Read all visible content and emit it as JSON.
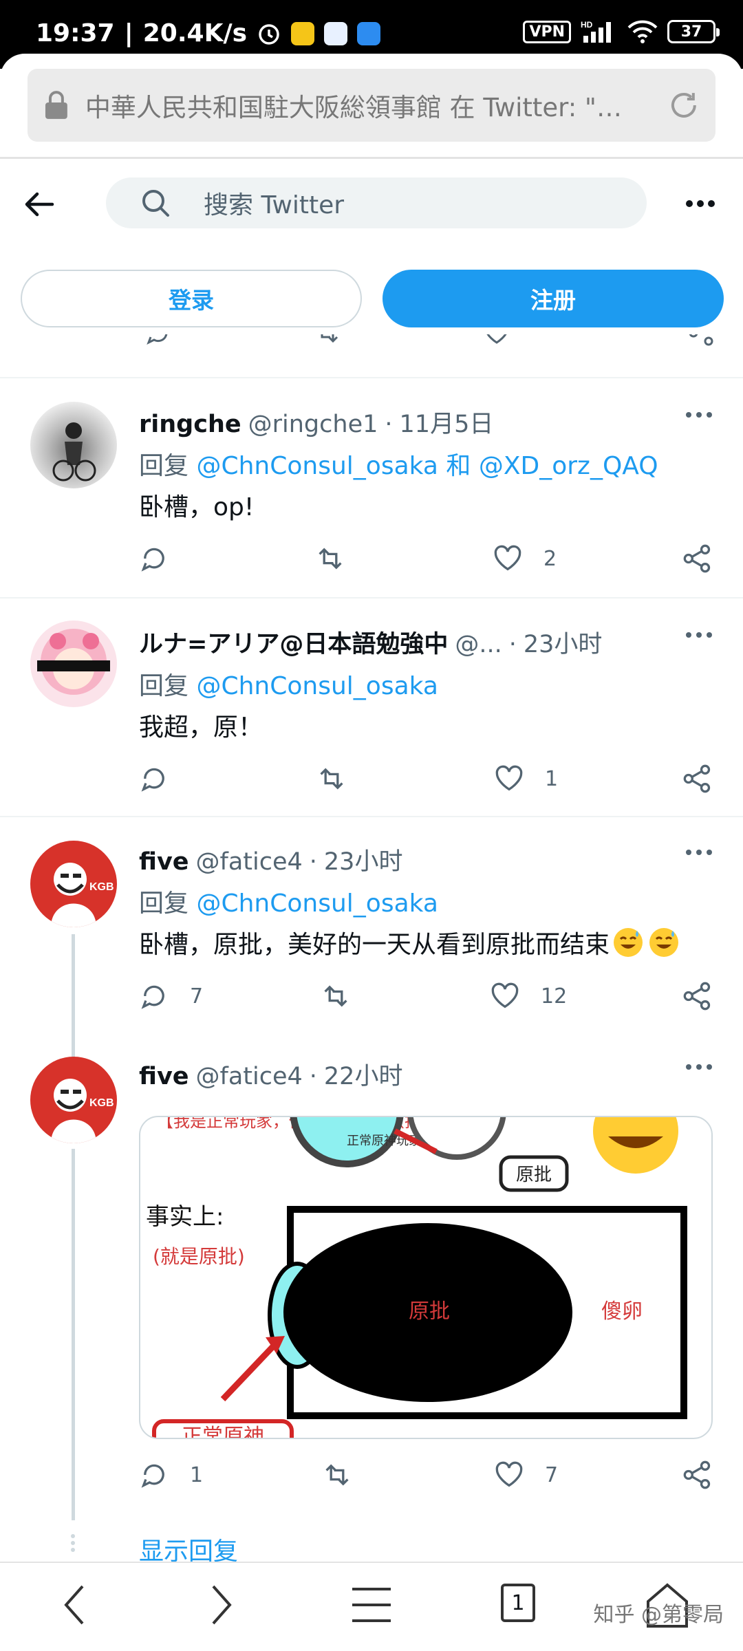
{
  "status_bar": {
    "time": "19:37",
    "speed": "20.4K/s",
    "vpn": "VPN",
    "hd": "HD",
    "battery": "37"
  },
  "browser": {
    "url_title": "中華人民共和国駐大阪総領事館 在 Twitter: \"…"
  },
  "header": {
    "search_placeholder": "搜索 Twitter"
  },
  "auth": {
    "login_label": "登录",
    "signup_label": "注册"
  },
  "tweets": [
    {
      "name": "ringche",
      "handle": "@ringche1",
      "sep": "·",
      "time": "11月5日",
      "reply_prefix": "回复",
      "mention1": "@ChnConsul_osaka",
      "mention_joiner": "和",
      "mention2": "@XD_orz_QAQ",
      "text": "卧槽，op!",
      "likes": "2"
    },
    {
      "name": "ルナ=アリア@日本語勉強中",
      "handle": "@...",
      "sep": "·",
      "time": "23小时",
      "reply_prefix": "回复",
      "mention1": "@ChnConsul_osaka",
      "text": "我超，原！",
      "likes": "1"
    },
    {
      "name": "five",
      "handle": "@fatice4",
      "sep": "·",
      "time": "23小时",
      "reply_prefix": "回复",
      "mention1": "@ChnConsul_osaka",
      "text": "卧槽，原批，美好的一天从看到原批而结束",
      "replies": "7",
      "likes": "12"
    },
    {
      "name": "five",
      "handle": "@fatice4",
      "sep": "·",
      "time": "22小时",
      "replies": "1",
      "likes": "7",
      "image": {
        "top_text": "【我是正常玩家，你不能骂我们（指对号入座）】",
        "circle_label_top": "正常原神玩家",
        "yuanpi_tag": "原批",
        "fact_label": "事实上:",
        "fact_sub": "(就是原批)",
        "center_label": "原批",
        "right_label": "傻卵",
        "bottom_label": "正常原神"
      }
    }
  ],
  "show_replies": "显示回复",
  "bottom_nav": {
    "tab_count": "1",
    "watermark": "知乎 @第零局"
  },
  "colors": {
    "accent": "#1d9bf0",
    "muted": "#536471"
  }
}
